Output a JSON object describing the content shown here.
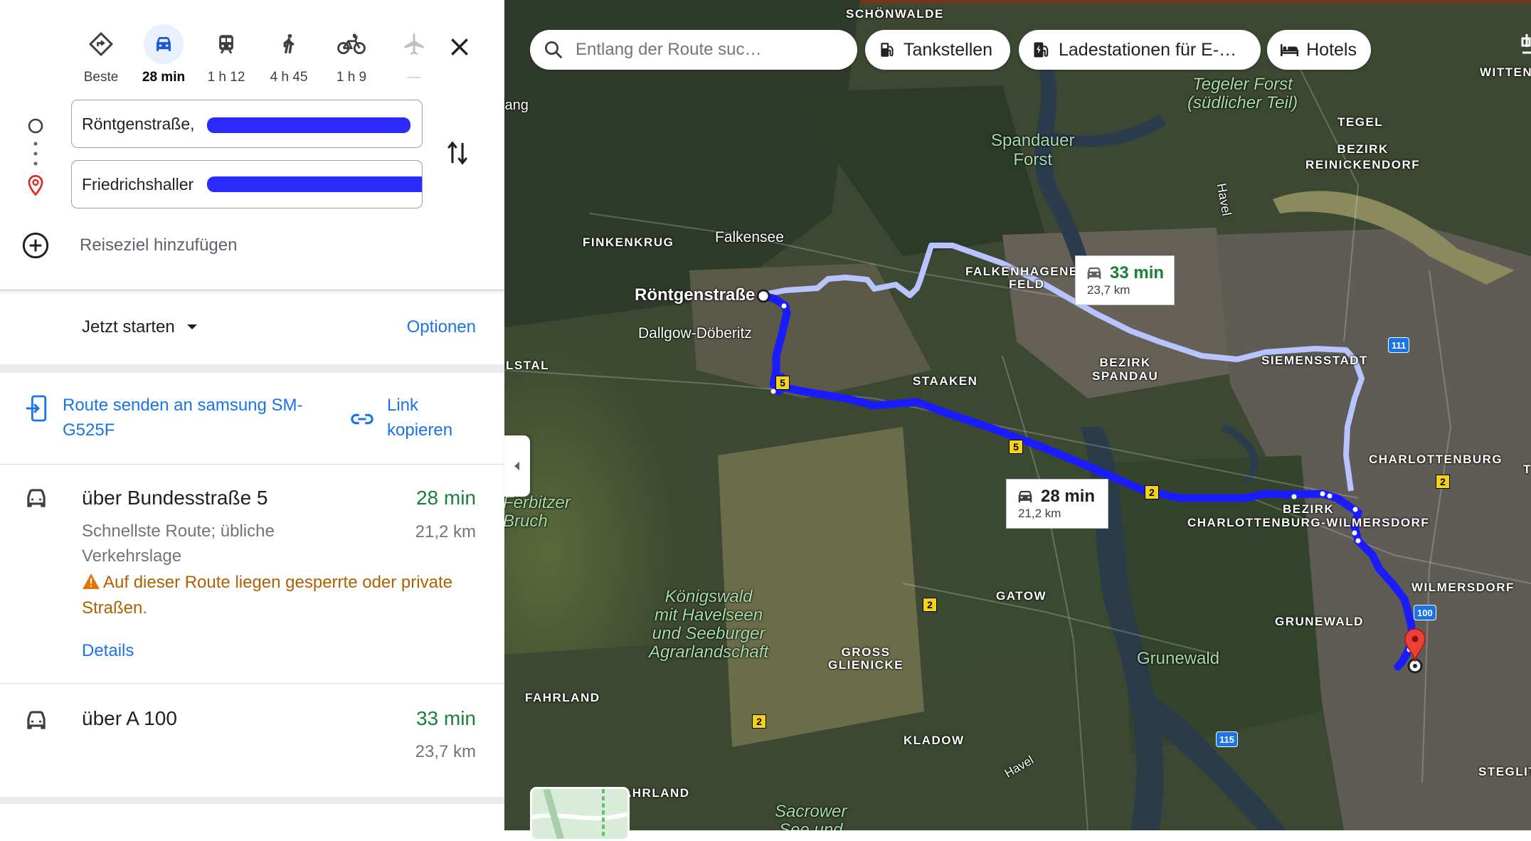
{
  "modes": [
    {
      "name": "best",
      "label": "Beste",
      "icon": "directions-diamond-icon",
      "active": false
    },
    {
      "name": "car",
      "label": "28 min",
      "icon": "car-icon",
      "active": true
    },
    {
      "name": "transit",
      "label": "1 h 12",
      "icon": "train-icon",
      "active": false
    },
    {
      "name": "walk",
      "label": "4 h 45",
      "icon": "walking-icon",
      "active": false
    },
    {
      "name": "bike",
      "label": "1 h 9",
      "icon": "bicycle-icon",
      "active": false
    },
    {
      "name": "flight",
      "label": "—",
      "icon": "airplane-icon",
      "active": false
    }
  ],
  "origin": {
    "value": "Röntgenstraße,"
  },
  "destination": {
    "value": "Friedrichshaller"
  },
  "add_destination": "Reiseziel hinzufügen",
  "depart": {
    "label": "Jetzt starten",
    "options": "Optionen"
  },
  "share": {
    "send_label": "Route senden an samsung SM-G525F",
    "link_label": "Link kopieren"
  },
  "routes": [
    {
      "title": "über Bundesstraße 5",
      "time": "28 min",
      "distance": "21,2 km",
      "subtitle": "Schnellste Route; übliche Verkehrslage",
      "warning": "Auf dieser Route liegen gesperrte oder private Straßen.",
      "details": "Details"
    },
    {
      "title": "über A 100",
      "time": "33 min",
      "distance": "23,7 km"
    }
  ],
  "map": {
    "search_placeholder": "Entlang der Route suc…",
    "chips": [
      "Tankstellen",
      "Ladestationen für E-…",
      "Hotels"
    ],
    "callouts": [
      {
        "time": "33 min",
        "distance": "23,7 km"
      },
      {
        "time": "28 min",
        "distance": "21,2 km"
      }
    ],
    "labels": {
      "schoenwalde": "SCHÖNWALDE",
      "witten": "WITTEN",
      "tegeler": "Tegeler Forst\n(südlicher Teil)",
      "tegel": "TEGEL",
      "bezirk_rein": "BEZIRK\nREINICKENDORF",
      "spandauer": "Spandauer\nForst",
      "havel1": "Havel",
      "lang": "lang",
      "finkenkrug": "FINKENKRUG",
      "falkensee": "Falkensee",
      "falkenhagener": "FALKENHAGENER\nFELD",
      "roentgen": "Röntgenstraße",
      "dallgow": "Dallgow-Döberitz",
      "lstal": "LSTAL",
      "staaken": "STAAKEN",
      "bezirk_spandau": "BEZIRK\nSPANDAU",
      "siemensstadt": "SIEMENSSTADT",
      "charlottenburg": "CHARLOTTENBURG",
      "bezirk_cw": "BEZIRK\nCHARLOTTENBURG-WILMERSDORF",
      "ferbitzer": "Ferbitzer\nBruch",
      "wilmersdorf": "WILMERSDORF",
      "koenigswald": "Königswald\nmit Havelseen\nund Seeburger\nAgrarlandschaft",
      "gatow": "GATOW",
      "grunewald_caps": "GRUNEWALD",
      "gross": "GROSS\nGLIENICKE",
      "grunewald": "Grunewald",
      "fahrland": "FAHRLAND",
      "kladow": "KLADOW",
      "havel2": "Havel",
      "ahrland": "AHRLAND",
      "sacrower": "Sacrower\nSee und",
      "steglitz": "STEGLIT",
      "t": "T"
    },
    "shields": {
      "b5a": "5",
      "b5b": "5",
      "b2a": "2",
      "b2b": "2",
      "b2c": "2",
      "b2d": "2",
      "a111": "111",
      "a100": "100",
      "a115": "115"
    }
  },
  "colors": {
    "accent": "#1a73e8",
    "green": "#188038",
    "warning": "#b06000",
    "route": "#2e5bff",
    "alt_route": "#aeb9ff"
  }
}
